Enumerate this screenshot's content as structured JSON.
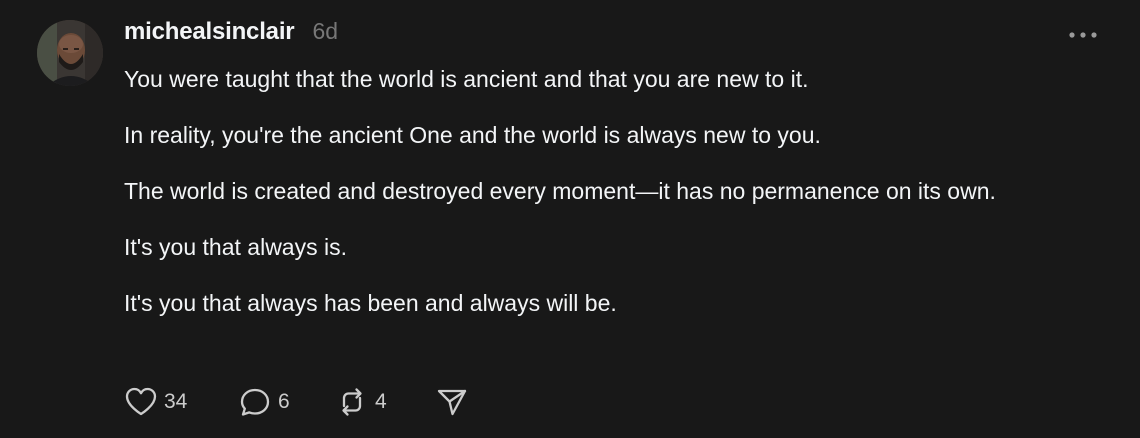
{
  "post": {
    "username": "michealsinclair",
    "timestamp": "6d",
    "paragraphs": [
      "You were taught that the world is ancient and that you are new to it.",
      "In reality, you're the ancient One and the world is always new to you.",
      "The world is created and destroyed every moment—it has no permanence on its own.",
      "It's you that always is.",
      "It's you that always has been and always will be."
    ],
    "actions": {
      "like_count": "34",
      "reply_count": "6",
      "repost_count": "4"
    },
    "icons": {
      "like": "heart-icon",
      "reply": "comment-bubble-icon",
      "repost": "repost-arrows-icon",
      "share": "paper-plane-icon",
      "more": "more-horizontal-icon"
    }
  },
  "colors": {
    "background": "#181818",
    "primary_text": "#f3f5f7",
    "secondary_text": "#777777",
    "icon": "#cccccc"
  }
}
